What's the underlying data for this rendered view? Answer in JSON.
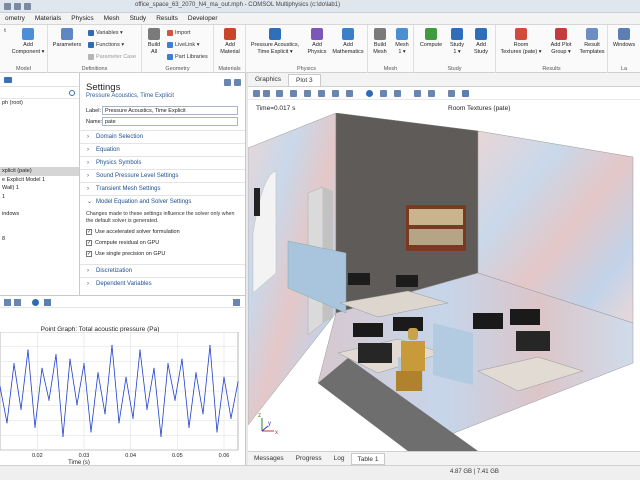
{
  "window": {
    "title": "office_space_63_2070_N4_ma_out.mph - COMSOL Multiphysics (c:\\do\\lab1)"
  },
  "menu": [
    "ometry",
    "Materials",
    "Physics",
    "Mesh",
    "Study",
    "Results",
    "Developer"
  ],
  "ribbon": {
    "model_group": {
      "buttons": [
        "Add\nComponent ▾"
      ],
      "left_stub": "t",
      "label": "Model"
    },
    "definitions_group": {
      "parameters": "Parameters",
      "variables": "Variables ▾",
      "functions": "Functions ▾",
      "param_case": "Parameter Case",
      "label": "Definitions"
    },
    "geometry_group": {
      "build_all": "Build\nAll",
      "import": "Import",
      "livelink": "LiveLink ▾",
      "part_libraries": "Part Libraries",
      "label": "Geometry"
    },
    "materials_group": {
      "add_material": "Add\nMaterial",
      "label": "Materials"
    },
    "physics_group": {
      "pressure_acoustics": "Pressure Acoustics,\nTime Explicit ▾",
      "add_physics": "Add\nPhysics",
      "add_mathematics": "Add\nMathematics",
      "label": "Physics"
    },
    "mesh_group": {
      "build_mesh": "Build\nMesh",
      "mesh1": "Mesh\n1 ▾",
      "label": "Mesh"
    },
    "study_group": {
      "compute": "Compute",
      "study1": "Study\n1 ▾",
      "add_study": "Add\nStudy",
      "label": "Study"
    },
    "results_group": {
      "room_textures": "Room\nTextures (pate) ▾",
      "add_plot_group": "Add Plot\nGroup ▾",
      "result_templates": "Result\nTemplates",
      "label": "Results"
    },
    "layout_group": {
      "windows": "Windows",
      "label": "La"
    }
  },
  "model_tree": {
    "items": [
      {
        "label": "ph (root)",
        "selected": false
      },
      {
        "label": "",
        "selected": false
      },
      {
        "label": "",
        "selected": false
      },
      {
        "label": "",
        "selected": false
      },
      {
        "label": "",
        "selected": false
      },
      {
        "label": "",
        "selected": false
      },
      {
        "label": "",
        "selected": false
      },
      {
        "label": "",
        "selected": false
      },
      {
        "label": "xplicit (pate)",
        "selected": true
      },
      {
        "label": "e Explicit Model 1",
        "selected": false
      },
      {
        "label": "Wall) 1",
        "selected": false
      },
      {
        "label": "1",
        "selected": false
      },
      {
        "label": "",
        "selected": false
      },
      {
        "label": "indows",
        "selected": false
      },
      {
        "label": "",
        "selected": false
      },
      {
        "label": "",
        "selected": false
      },
      {
        "label": "8",
        "selected": false
      },
      {
        "label": "",
        "selected": false
      },
      {
        "label": "",
        "selected": false
      }
    ]
  },
  "settings": {
    "title": "Settings",
    "subtitle": "Pressure Acoustics, Time Explicit",
    "label_field": {
      "label": "Label:",
      "value": "Pressure Acoustics, Time Explicit"
    },
    "name_field": {
      "label": "Name:",
      "value": "pate"
    },
    "sections": [
      "Domain Selection",
      "Equation",
      "Physics Symbols",
      "Sound Pressure Level Settings",
      "Transient Mesh Settings",
      "Model Equation and Solver Settings"
    ],
    "solver_desc": "Changes made to these settings influence the solver only when the default solver is generated.",
    "checkboxes": [
      {
        "label": "Use accelerated solver formulation",
        "checked": true
      },
      {
        "label": "Compute residual on GPU",
        "checked": true
      },
      {
        "label": "Use single precision on GPU",
        "checked": true
      }
    ],
    "bottom_sections": [
      "Discretization",
      "Dependent Variables"
    ]
  },
  "graph": {
    "title": "Point Graph: Total acoustic pressure (Pa)",
    "xlabel": "Time (s)",
    "xticks": [
      "0.02",
      "0.03",
      "0.04",
      "0.05",
      "0.06"
    ]
  },
  "chart_data": {
    "type": "line",
    "title": "Point Graph: Total acoustic pressure (Pa)",
    "xlabel": "Time (s)",
    "ylabel": "",
    "xlim": [
      0.012,
      0.063
    ],
    "ylim": [
      -1.3,
      1.3
    ],
    "series": [
      {
        "color": "#1f3fcf",
        "x": [
          0.012,
          0.0135,
          0.015,
          0.0165,
          0.018,
          0.0195,
          0.021,
          0.0225,
          0.024,
          0.0255,
          0.027,
          0.0285,
          0.03,
          0.0315,
          0.033,
          0.0345,
          0.036,
          0.0375,
          0.039,
          0.0405,
          0.042,
          0.0435,
          0.045,
          0.0465,
          0.048,
          0.0495,
          0.051,
          0.0525,
          0.054,
          0.0555,
          0.057,
          0.0585,
          0.06,
          0.0615,
          0.063
        ],
        "y": [
          0.1,
          -0.7,
          0.6,
          -0.4,
          0.9,
          -0.8,
          0.5,
          -0.2,
          0.8,
          -1.0,
          0.7,
          -0.3,
          0.6,
          -0.9,
          0.4,
          -0.5,
          1.0,
          -0.7,
          0.3,
          -0.6,
          0.9,
          -0.4,
          0.5,
          -1.0,
          0.6,
          -0.2,
          0.7,
          -0.8,
          0.4,
          -0.5,
          1.0,
          -0.9,
          0.3,
          -0.6,
          0.2
        ]
      }
    ]
  },
  "graphics": {
    "tabs": [
      "Graphics",
      "Plot 3"
    ],
    "time_label": "Time=0.017 s",
    "plot_title": "Room Textures (pate)",
    "axes_labels": [
      "z",
      "y",
      "x"
    ]
  },
  "bottom_tabs": [
    "Messages",
    "Progress",
    "Log",
    "Table 1"
  ],
  "status": {
    "memory": "4.87 GB | 7.41 GB"
  },
  "colors": {
    "accent": "#1f4f8f",
    "ribbon_bg": "#fafafa",
    "selected": "#d5d5d5"
  }
}
